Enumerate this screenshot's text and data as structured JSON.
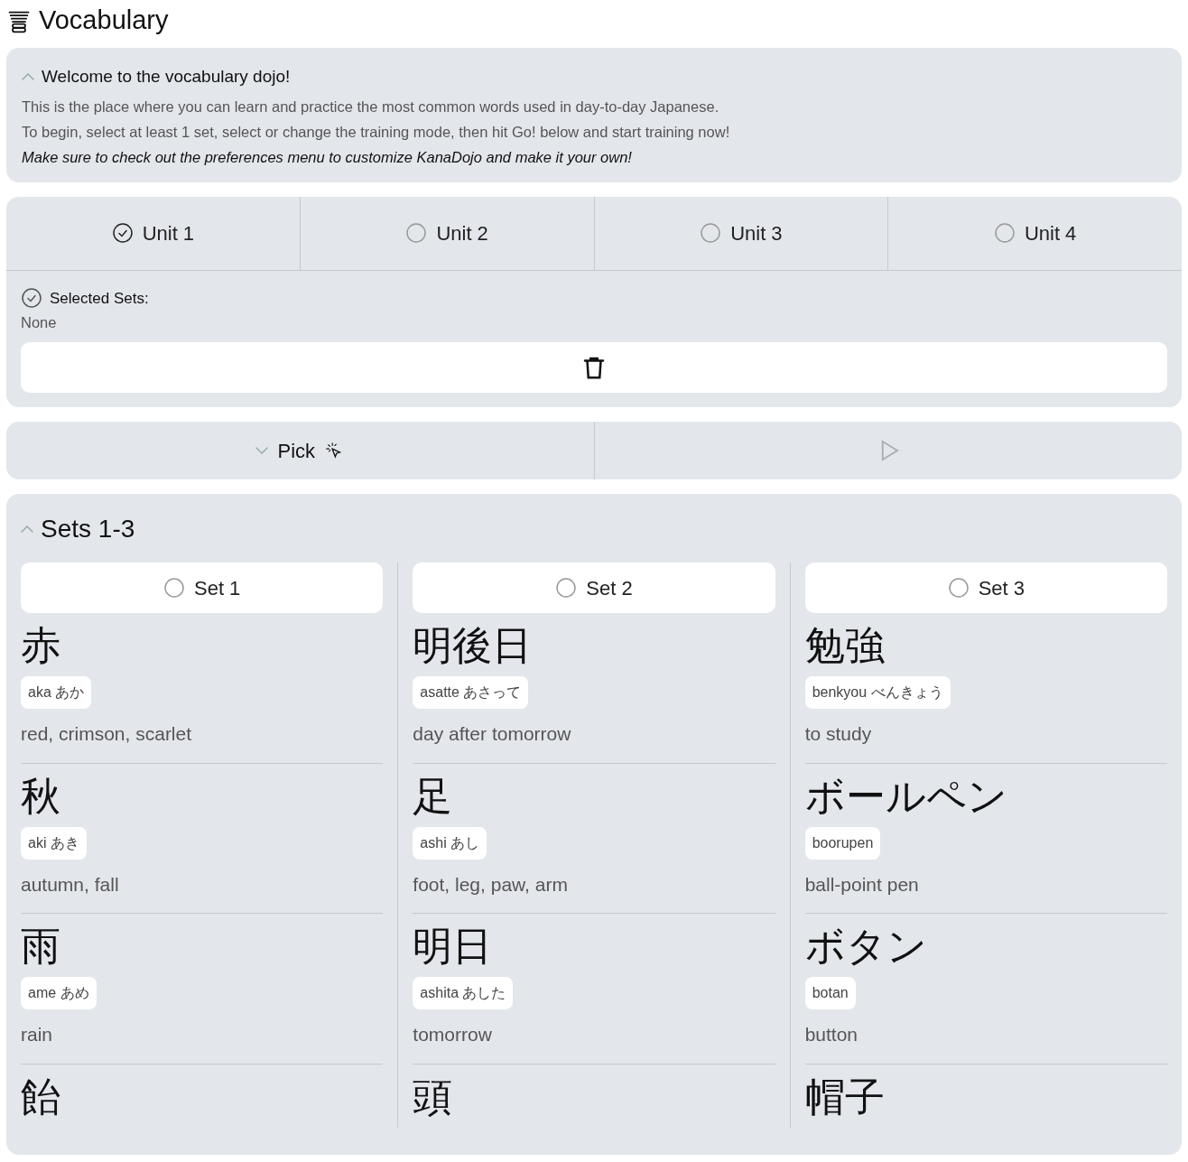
{
  "header": {
    "title": "Vocabulary"
  },
  "welcome": {
    "expanded": true,
    "title": "Welcome to the vocabulary dojo!",
    "lines": [
      "This is the place where you can learn and practice the most common words used in day-to-day Japanese.",
      "To begin, select at least 1 set, select or change the training mode, then hit Go! below and start training now!"
    ],
    "note": "Make sure to check out the preferences menu to customize KanaDojo and make it your own!"
  },
  "units": [
    {
      "label": "Unit 1",
      "selected": true
    },
    {
      "label": "Unit 2",
      "selected": false
    },
    {
      "label": "Unit 3",
      "selected": false
    },
    {
      "label": "Unit 4",
      "selected": false
    }
  ],
  "selected_sets": {
    "label": "Selected Sets:",
    "value": "None"
  },
  "mode_bar": {
    "pick_label": "Pick",
    "expanded": false,
    "go_disabled": true
  },
  "sets_group": {
    "title": "Sets 1-3",
    "expanded": true,
    "sets": [
      {
        "label": "Set 1",
        "selected": false,
        "words": [
          {
            "word": "赤",
            "reading": "aka あか",
            "meaning": "red, crimson, scarlet"
          },
          {
            "word": "秋",
            "reading": "aki あき",
            "meaning": "autumn, fall"
          },
          {
            "word": "雨",
            "reading": "ame あめ",
            "meaning": "rain"
          },
          {
            "word": "飴"
          }
        ]
      },
      {
        "label": "Set 2",
        "selected": false,
        "words": [
          {
            "word": "明後日",
            "reading": "asatte あさって",
            "meaning": "day after tomorrow"
          },
          {
            "word": "足",
            "reading": "ashi あし",
            "meaning": "foot, leg, paw, arm"
          },
          {
            "word": "明日",
            "reading": "ashita あした",
            "meaning": "tomorrow"
          },
          {
            "word": "頭"
          }
        ]
      },
      {
        "label": "Set 3",
        "selected": false,
        "words": [
          {
            "word": "勉強",
            "reading": "benkyou べんきょう",
            "meaning": "to study"
          },
          {
            "word": "ボールペン",
            "reading": "boorupen",
            "meaning": "ball-point pen"
          },
          {
            "word": "ボタン",
            "reading": "botan",
            "meaning": "button"
          },
          {
            "word": "帽子"
          }
        ]
      }
    ]
  }
}
